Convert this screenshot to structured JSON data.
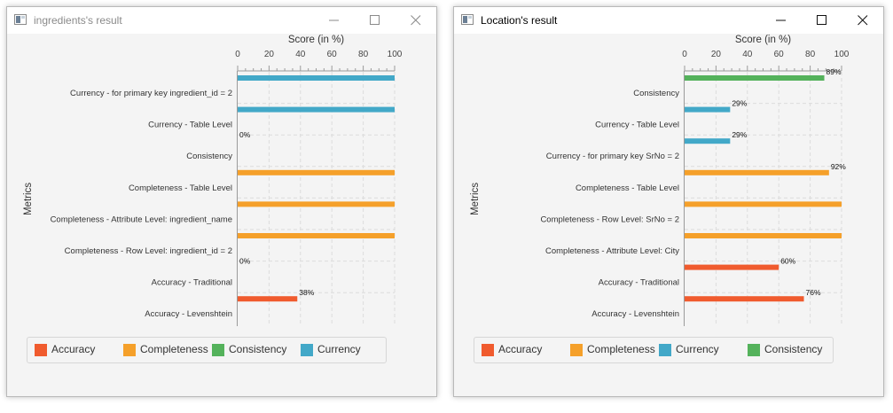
{
  "colors": {
    "Accuracy": "#f05b2e",
    "Completeness": "#f5a02a",
    "Consistency": "#54b25b",
    "Currency": "#42a8c8"
  },
  "windows": [
    {
      "title": "ingredients's result",
      "active": false,
      "chart_data": {
        "type": "bar",
        "orientation": "horizontal",
        "xlabel": "Score (in %)",
        "ylabel": "Metrics",
        "xlim": [
          0,
          100
        ],
        "x_ticks": [
          "0",
          "20",
          "40",
          "60",
          "80",
          "100"
        ],
        "categories": [
          "Currency - for primary key ingredient_id = 2",
          "Currency - Table Level",
          "Consistency",
          "Completeness - Table Level",
          "Completeness - Attribute Level: ingredient_name",
          "Completeness - Row Level: ingredient_id = 2",
          "Accuracy - Traditional",
          "Accuracy - Levenshtein"
        ],
        "values": [
          100,
          100,
          0,
          100,
          100,
          100,
          0,
          38
        ],
        "bar_groups": [
          "Currency",
          "Currency",
          "Consistency",
          "Completeness",
          "Completeness",
          "Completeness",
          "Accuracy",
          "Accuracy"
        ],
        "data_labels": [
          "",
          "",
          "0%",
          "",
          "",
          "",
          "0%",
          "38%"
        ],
        "grid": true,
        "legend": [
          "Accuracy",
          "Completeness",
          "Consistency",
          "Currency"
        ],
        "legend_position": "bottom"
      }
    },
    {
      "title": "Location's result",
      "active": true,
      "chart_data": {
        "type": "bar",
        "orientation": "horizontal",
        "xlabel": "Score (in %)",
        "ylabel": "Metrics",
        "xlim": [
          0,
          100
        ],
        "x_ticks": [
          "0",
          "20",
          "40",
          "60",
          "80",
          "100"
        ],
        "categories": [
          "Consistency",
          "Currency - Table Level",
          "Currency - for primary key SrNo = 2",
          "Completeness - Table Level",
          "Completeness - Row Level: SrNo = 2",
          "Completeness - Attribute Level: City",
          "Accuracy - Traditional",
          "Accuracy - Levenshtein"
        ],
        "values": [
          89,
          29,
          29,
          92,
          100,
          100,
          60,
          76
        ],
        "bar_groups": [
          "Consistency",
          "Currency",
          "Currency",
          "Completeness",
          "Completeness",
          "Completeness",
          "Accuracy",
          "Accuracy"
        ],
        "data_labels": [
          "89%",
          "29%",
          "29%",
          "92%",
          "",
          "",
          "60%",
          "76%"
        ],
        "grid": true,
        "legend": [
          "Accuracy",
          "Completeness",
          "Currency",
          "Consistency"
        ],
        "legend_position": "bottom"
      }
    }
  ]
}
